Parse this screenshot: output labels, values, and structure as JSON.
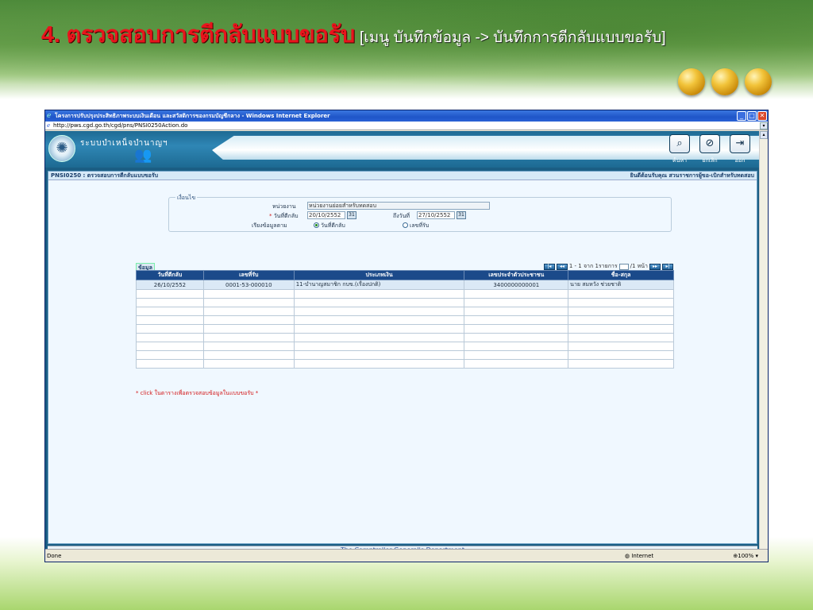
{
  "slide": {
    "title_main": "4. ตรวจสอบการตีกลับแบบขอรับ",
    "title_sub": "[เมนู บันทึกข้อมูล -> บันทึกการตีกลับแบบขอรับ]"
  },
  "browser": {
    "window_title": "โครงการปรับปรุงประสิทธิภาพระบบเงินเดือน และสวัสดิการของกรมบัญชีกลาง - Windows Internet Explorer",
    "url": "http://pws.cgd.go.th/cgd/pns/PNSI0250Action.do",
    "status": "Done",
    "zone": "Internet",
    "zoom": "100%"
  },
  "app": {
    "system_name": "ระบบบำเหน็จบำนาญฯ",
    "toolbar": {
      "search": "ค้นหา",
      "cancel": "ยกเลิก",
      "exit": "ออก"
    },
    "page_code": "PNSI0250 : ตรวจสอบการตีกลับแบบขอรับ",
    "welcome": "ยินดีต้อนรับคุณ สวนราชการผู้ขอ-เบิกสำหรับทดสอบ",
    "footer": "The Comptroller General's Department"
  },
  "criteria": {
    "legend": "เงื่อนไข",
    "unit_label": "หน่วยงาน",
    "unit_value": "หน่วยงานย่อยสำหรับทดสอบ",
    "from_label": "วันที่ตีกลับ",
    "from_value": "20/10/2552",
    "to_label": "ถึงวันที่",
    "to_value": "27/10/2552",
    "sort_label": "เรียงข้อมูลตาม",
    "sort_opt1": "วันที่ตีกลับ",
    "sort_opt2": "เลขที่รับ",
    "required_mark": "*",
    "cal_glyph": "31"
  },
  "grid": {
    "tab": "ข้อมูล",
    "pager_text": "1 - 1 จาก 1รายการ",
    "pager_of": "/1 หน้า",
    "columns": [
      "วันที่ตีกลับ",
      "เลขที่รับ",
      "ประเภทเงิน",
      "เลขประจำตัวประชาชน",
      "ชื่อ-สกุล"
    ],
    "rows": [
      [
        "26/10/2552",
        "0001-53-000010",
        "11-บำนาญสมาชิก กบข.(เรื่องปกติ)",
        "3400000000001",
        "นาย สมหวัง ช่วยชาติ"
      ]
    ],
    "hint": "* click ในตารางเพื่อตรวจสอบข้อมูลในแบบขอรับ *"
  }
}
